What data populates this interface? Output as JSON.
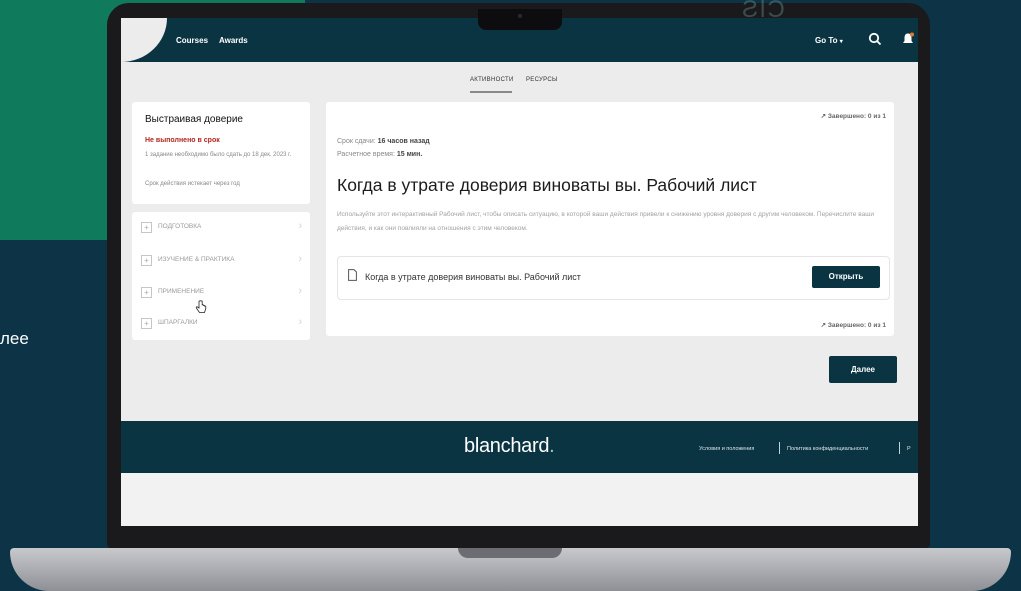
{
  "background": {
    "left_text": "лее",
    "accent": "#0f7a5c",
    "navy": "#0b3443"
  },
  "header": {
    "nav": [
      "Courses",
      "Awards"
    ],
    "goto_label": "Go To",
    "goto_icon": "chevron-down-icon",
    "search_icon": "search-icon",
    "bell_icon": "bell-icon"
  },
  "tabs": [
    {
      "label": "АКТИВНОСТИ",
      "active": true
    },
    {
      "label": "РЕСУРСЫ",
      "active": false
    }
  ],
  "sidebar": {
    "title": "Выстраивая доверие",
    "status": "Не выполнено в срок",
    "note": "1 задание необходимо было сдать до 18 дек. 2023 г.",
    "expire": "Срок действия истекает через год",
    "steps": [
      {
        "label": "ПОДГОТОВКА"
      },
      {
        "label": "ИЗУЧЕНИЕ & ПРАКТИКА"
      },
      {
        "label": "ПРИМЕНЕНИЕ"
      },
      {
        "label": "ШПАРГАЛКИ"
      }
    ]
  },
  "main": {
    "progress": "Завершено: 0 из 1",
    "due_label": "Срок сдачи:",
    "due_value": "16 часов назад",
    "time_label": "Расчетное время:",
    "time_value": "15 мин.",
    "title": "Когда в утрате доверия виноваты вы. Рабочий лист",
    "description": "Используйте этот интерактивный Рабочий лист, чтобы описать ситуацию, в которой ваши действия привели к снижению уровня доверия с другим человеком. Перечислите ваши действия, и как они повлияли на отношения с этим человеком.",
    "resource_title": "Когда в утрате доверия виноваты вы. Рабочий лист",
    "open_label": "Открыть",
    "next_label": "Далее"
  },
  "footer": {
    "brand": "blanchard",
    "brand_dot": ".",
    "links": [
      "Условия и положения",
      "Политика конфиденциальности",
      "Р"
    ]
  }
}
